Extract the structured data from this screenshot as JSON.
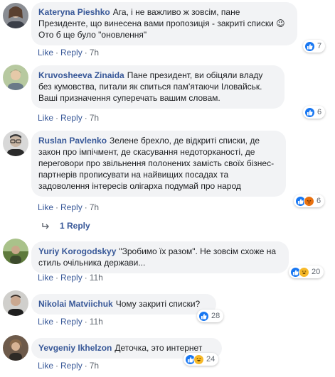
{
  "comments": [
    {
      "author": "Kateryna Pieshko",
      "text": "Ага, і не важливо ж зовсім, пане Президенте, що винесена вами пропозиція - закриті списки 😉 Ото б ще було \"оновлення\"",
      "like": "Like",
      "reply": "Reply",
      "time": "7h",
      "reactions": [
        "like"
      ],
      "reaction_count": "7"
    },
    {
      "author": "Kruvosheeva Zinaida",
      "text": "Пане президент, ви обіцяли владу без кумовства, питали як спиться пам'ятаючи Іловайськ. Ваші призначення суперечать вашим словам.",
      "like": "Like",
      "reply": "Reply",
      "time": "7h",
      "reactions": [
        "like"
      ],
      "reaction_count": "6"
    },
    {
      "author": "Ruslan Pavlenko",
      "text": "Зелене брехло, де відкриті списки, де закон про імпічмент, де скасування недоторканості, де переговори про звільнення полонених замість своїх бізнес-партнерів прописувати на найвищих посадах та задоволення інтересів олігарха подумай про народ",
      "like": "Like",
      "reply": "Reply",
      "time": "7h",
      "reactions": [
        "like",
        "angry"
      ],
      "reaction_count": "6"
    },
    {
      "author": "Yuriy Korogodskyy",
      "text": "\"Зробимо їх разом\". Не зовсім схоже на стиль очільника держави...",
      "like": "Like",
      "reply": "Reply",
      "time": "11h",
      "reactions": [
        "like",
        "haha"
      ],
      "reaction_count": "20"
    },
    {
      "author": "Nikolai Matviichuk",
      "text": "Чому закриті списки?",
      "like": "Like",
      "reply": "Reply",
      "time": "11h",
      "reactions": [
        "like"
      ],
      "reaction_count": "28"
    },
    {
      "author": "Yevgeniy Ikhelzon",
      "text": "Деточка, это интернет",
      "like": "Like",
      "reply": "Reply",
      "time": "7h",
      "reactions": [
        "like",
        "haha"
      ],
      "reaction_count": "24"
    }
  ],
  "replies_link": "1 Reply",
  "icons": {
    "reply_arrow": "reply-arrow-icon",
    "like": "thumbs-up-icon",
    "haha": "laughing-face-icon",
    "angry": "angry-face-icon"
  },
  "colors": {
    "link": "#385898",
    "bubble": "#f2f3f5",
    "like_reaction": "#1877f2",
    "haha_reaction": "#f7b928",
    "angry_reaction": "#e9710f"
  }
}
